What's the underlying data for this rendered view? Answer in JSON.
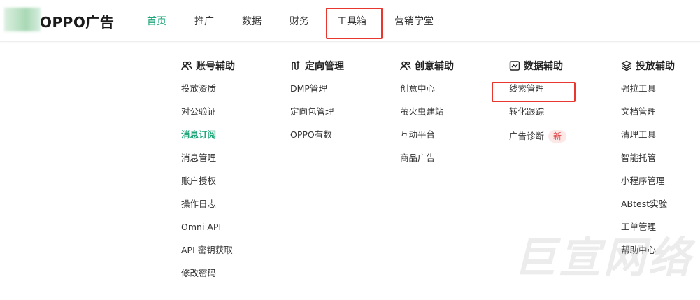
{
  "header": {
    "logo_text": "OPPO广告",
    "nav": [
      {
        "label": "首页",
        "active": true
      },
      {
        "label": "推广",
        "active": false
      },
      {
        "label": "数据",
        "active": false
      },
      {
        "label": "财务",
        "active": false
      },
      {
        "label": "工具箱",
        "active": false
      },
      {
        "label": "营销学堂",
        "active": false
      }
    ]
  },
  "menu": {
    "columns": [
      {
        "title": "账号辅助",
        "icon": "users-icon",
        "items": [
          "投放资质",
          "对公验证",
          "消息订阅",
          "消息管理",
          "账户授权",
          "操作日志",
          "Omni API",
          "API 密钥获取",
          "修改密码"
        ]
      },
      {
        "title": "定向管理",
        "icon": "targeting-icon",
        "items": [
          "DMP管理",
          "定向包管理",
          "OPPO有数"
        ]
      },
      {
        "title": "创意辅助",
        "icon": "users-icon",
        "items": [
          "创意中心",
          "萤火虫建站",
          "互动平台",
          "商品广告"
        ]
      },
      {
        "title": "数据辅助",
        "icon": "chart-icon",
        "items": [
          "线索管理",
          "转化跟踪",
          "广告诊断"
        ],
        "badge": "新"
      },
      {
        "title": "投放辅助",
        "icon": "layers-icon",
        "items": [
          "强拉工具",
          "文档管理",
          "清理工具",
          "智能托管",
          "小程序管理",
          "ABtest实验",
          "工单管理",
          "帮助中心"
        ]
      }
    ]
  },
  "watermark": "巨宣网络",
  "colors": {
    "accent": "#1fa67a",
    "highlight": "#e8372e",
    "badge_bg": "#fde8e8",
    "badge_text": "#e04a4a"
  }
}
